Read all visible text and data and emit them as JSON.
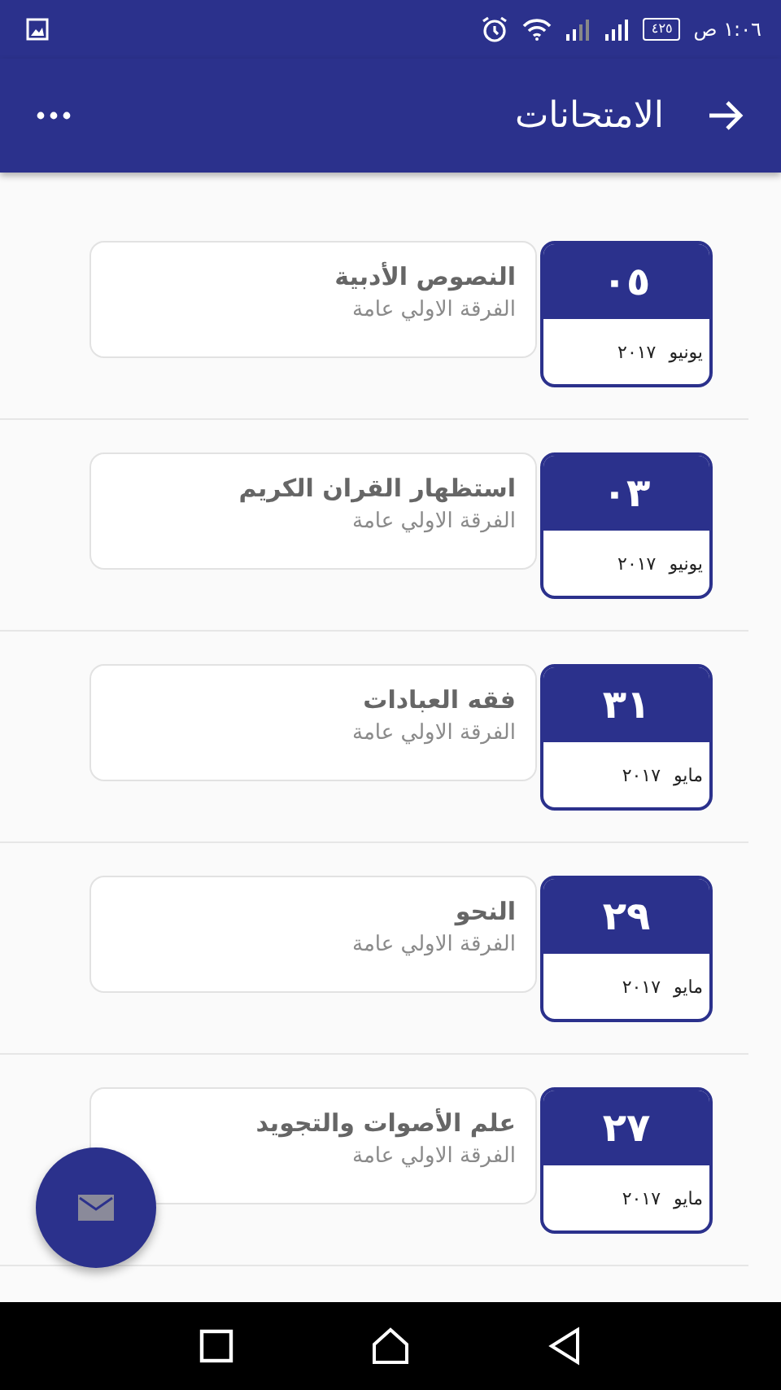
{
  "status_bar": {
    "time": "١:٠٦ ص",
    "battery": "٤٢٥"
  },
  "app_bar": {
    "title": "الامتحانات"
  },
  "exams": [
    {
      "day": "٠٥",
      "month": "يونيو",
      "year": "٢٠١٧",
      "title": "النصوص الأدبية",
      "group": "الفرقة الاولي عامة"
    },
    {
      "day": "٠٣",
      "month": "يونيو",
      "year": "٢٠١٧",
      "title": "استظهار القران الكريم",
      "group": "الفرقة الاولي عامة"
    },
    {
      "day": "٣١",
      "month": "مايو",
      "year": "٢٠١٧",
      "title": "فقه العبادات",
      "group": "الفرقة الاولي عامة"
    },
    {
      "day": "٢٩",
      "month": "مايو",
      "year": "٢٠١٧",
      "title": "النحو",
      "group": "الفرقة الاولي عامة"
    },
    {
      "day": "٢٧",
      "month": "مايو",
      "year": "٢٠١٧",
      "title": "علم الأصوات والتجويد",
      "group": "الفرقة الاولي عامة"
    }
  ]
}
